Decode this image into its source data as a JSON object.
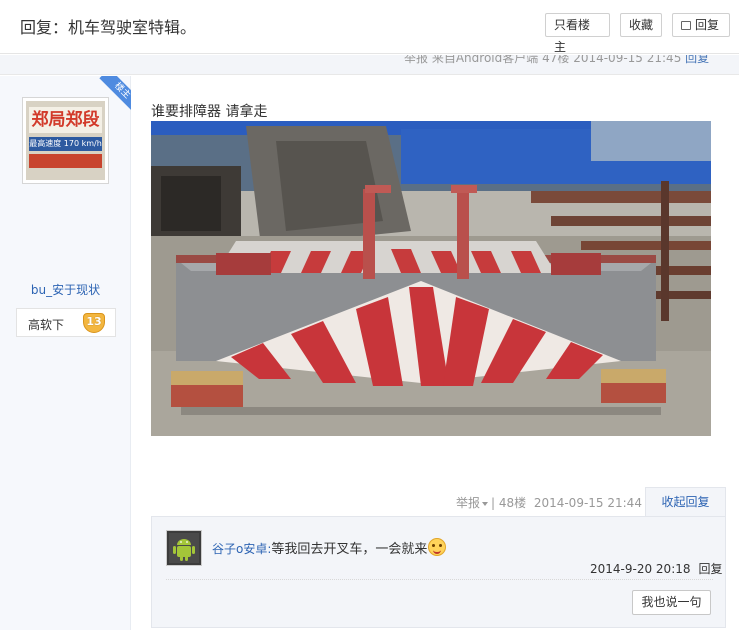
{
  "header": {
    "title": "回复：机车驾驶室特辑。",
    "only_author_label": "只看楼主",
    "favorite_label": "收藏",
    "reply_label": "回复"
  },
  "band": {
    "report_label": "举报",
    "source_text": "来自Android客户端",
    "floor": "47楼",
    "datetime": "2014-09-15 21:45",
    "reply_label": "回复"
  },
  "author": {
    "badge": "楼主",
    "avatar_text_top": "郑局郑段",
    "avatar_text_mid": "最高速度 170 km/h",
    "username": "bu_安于现状",
    "level_title": "高软下",
    "level_number": "13"
  },
  "post": {
    "text": "谁要排障器 请拿走"
  },
  "post_tail": {
    "report_label": "举报",
    "separator": "|",
    "floor": "48楼",
    "datetime": "2014-09-15 21:44",
    "collapse_label": "收起回复"
  },
  "comments": {
    "items": [
      {
        "user": "谷子o安卓",
        "separator": ":",
        "text": "等我回去开叉车，一会就来",
        "datetime": "2014-9-20 20:18",
        "reply_label": "回复"
      }
    ],
    "say_label": "我也说一句"
  },
  "colors": {
    "link_blue": "#2d64b3",
    "level_badge": "#f3b63f",
    "ribbon": "#4f8be0"
  },
  "icons": {
    "reply": "speech-bubble-icon",
    "level": "shield-badge-icon",
    "emoji": "grin-face-icon",
    "caret": "caret-down-icon"
  }
}
